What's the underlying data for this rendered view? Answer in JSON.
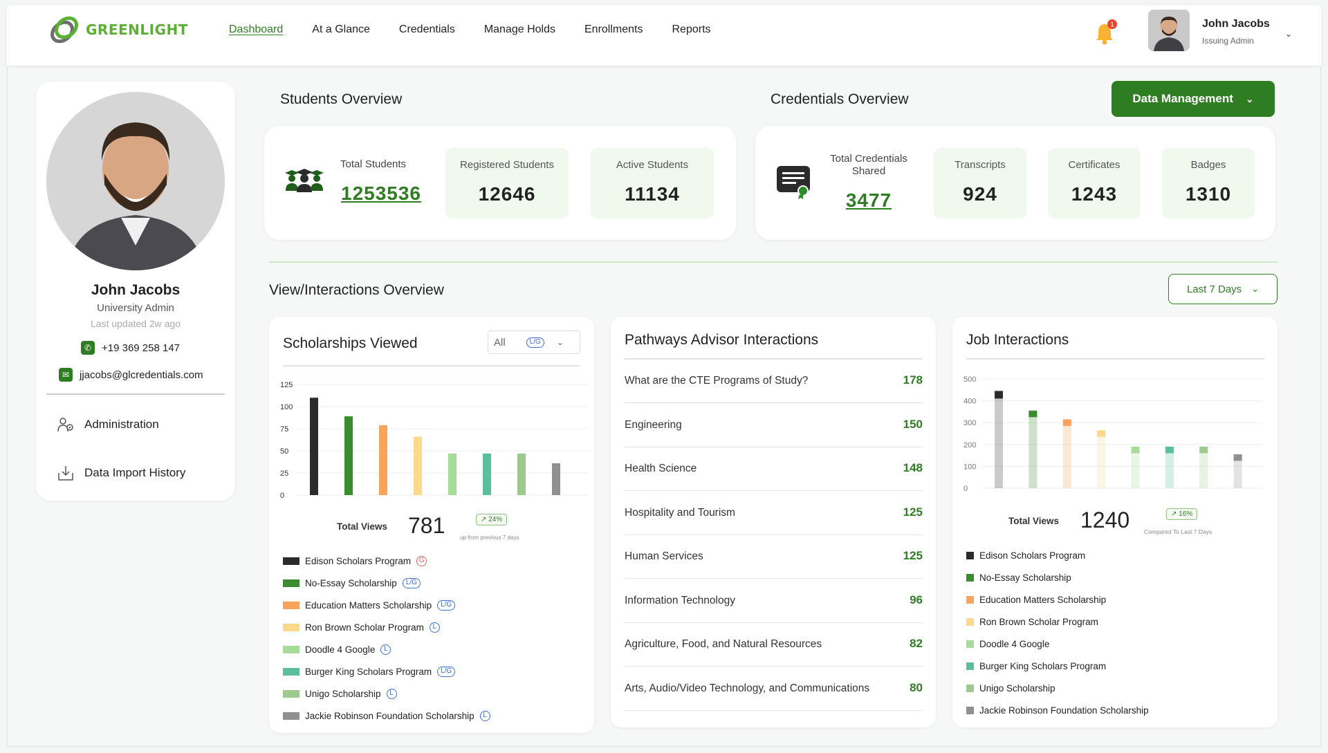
{
  "brand": {
    "name": "GREENLIGHT"
  },
  "nav": {
    "items": [
      "Dashboard",
      "At a Glance",
      "Credentials",
      "Manage Holds",
      "Enrollments",
      "Reports"
    ],
    "notifications": "1"
  },
  "user": {
    "name": "John Jacobs",
    "role": "Issuing Admin"
  },
  "profile": {
    "name": "John Jacobs",
    "role": "University Admin",
    "updated": "Last updated 2w ago",
    "phone": "+19 369 258 147",
    "email": "jjacobs@glcredentials.com",
    "menu": [
      "Administration",
      "Data Import History"
    ]
  },
  "students": {
    "title": "Students Overview",
    "total_label": "Total Students",
    "total": "1253536",
    "registered_label": "Registered Students",
    "registered": "12646",
    "active_label": "Active Students",
    "active": "11134"
  },
  "credentials": {
    "title": "Credentials Overview",
    "shared_label_1": "Total Credentials",
    "shared_label_2": "Shared",
    "shared": "3477",
    "transcripts_label": "Transcripts",
    "transcripts": "924",
    "certificates_label": "Certificates",
    "certificates": "1243",
    "badges_label": "Badges",
    "badges": "1310"
  },
  "data_management": "Data Management",
  "views": {
    "title": "View/Interactions Overview",
    "range": "Last 7 Days"
  },
  "colors": {
    "accent": "#2f7d23",
    "series": [
      "#2b2b2b",
      "#3a8d2e",
      "#f7a35c",
      "#fbd88a",
      "#a7dc98",
      "#5cbf9b",
      "#9ccb8d",
      "#909090"
    ]
  },
  "scholarships": {
    "title": "Scholarships Viewed",
    "filter": "All",
    "filter_tag": "L/G",
    "total_label": "Total Views",
    "total": "781",
    "trend": "24%",
    "trend_note": "up from previous 7 days",
    "legend": [
      {
        "name": "Edison Scholars Program",
        "tag": "G"
      },
      {
        "name": "No-Essay Scholarship",
        "tag": "L/G"
      },
      {
        "name": "Education Matters Scholarship",
        "tag": "L/G"
      },
      {
        "name": "Ron Brown Scholar Program",
        "tag": "L"
      },
      {
        "name": "Doodle 4 Google",
        "tag": "L"
      },
      {
        "name": "Burger King Scholars Program",
        "tag": "L/G"
      },
      {
        "name": "Unigo Scholarship",
        "tag": "L"
      },
      {
        "name": "Jackie Robinson Foundation Scholarship",
        "tag": "L"
      }
    ]
  },
  "pathways": {
    "title": "Pathways Advisor Interactions",
    "rows": [
      {
        "name": "What are the CTE Programs of Study?",
        "value": "178"
      },
      {
        "name": "Engineering",
        "value": "150"
      },
      {
        "name": "Health Science",
        "value": "148"
      },
      {
        "name": "Hospitality and Tourism",
        "value": "125"
      },
      {
        "name": "Human Services",
        "value": "125"
      },
      {
        "name": "Information Technology",
        "value": "96"
      },
      {
        "name": "Agriculture, Food, and Natural Resources",
        "value": "82"
      },
      {
        "name": "Arts, Audio/Video Technology, and Communications",
        "value": "80"
      }
    ]
  },
  "jobs": {
    "title": "Job Interactions",
    "total_label": "Total Views",
    "total": "1240",
    "trend": "16%",
    "trend_note": "Compared To Last 7 Days",
    "legend": [
      "Edison Scholars Program",
      "No-Essay Scholarship",
      "Education Matters Scholarship",
      "Ron Brown Scholar Program",
      "Doodle 4 Google",
      "Burger King Scholars Program",
      "Unigo Scholarship",
      "Jackie Robinson Foundation Scholarship"
    ]
  },
  "chart_data": [
    {
      "type": "bar",
      "categories": [
        "Edison Scholars Program",
        "No-Essay Scholarship",
        "Education Matters Scholarship",
        "Ron Brown Scholar Program",
        "Doodle 4 Google",
        "Burger King Scholars Program",
        "Unigo Scholarship",
        "Jackie Robinson Foundation Scholarship"
      ],
      "values": [
        110,
        89,
        79,
        66,
        47,
        47,
        47,
        36
      ],
      "ylim": [
        0,
        125
      ],
      "yticks": [
        0,
        25,
        50,
        75,
        100,
        125
      ],
      "grid": true
    },
    {
      "type": "bar",
      "stacked": true,
      "categories": [
        "Edison Scholars Program",
        "No-Essay Scholarship",
        "Education Matters Scholarship",
        "Ron Brown Scholar Program",
        "Doodle 4 Google",
        "Burger King Scholars Program",
        "Unigo Scholarship",
        "Jackie Robinson Foundation Scholarship"
      ],
      "values": [
        445,
        355,
        315,
        265,
        190,
        190,
        190,
        155
      ],
      "highlight": [
        35,
        30,
        30,
        30,
        30,
        30,
        30,
        30
      ],
      "ylim": [
        0,
        500
      ],
      "yticks": [
        0,
        100,
        200,
        300,
        400,
        500
      ],
      "grid": true
    }
  ]
}
